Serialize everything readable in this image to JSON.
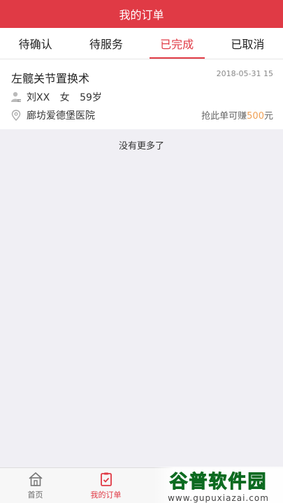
{
  "header": {
    "title": "我的订单"
  },
  "tabs": [
    {
      "label": "待确认"
    },
    {
      "label": "待服务"
    },
    {
      "label": "已完成"
    },
    {
      "label": "已取消"
    }
  ],
  "active_tab_index": 2,
  "order": {
    "procedure": "左髋关节置换术",
    "datetime": "2018-05-31 15",
    "patient_name": "刘XX",
    "patient_gender": "女",
    "patient_age": "59岁",
    "hospital": "廊坊爱德堡医院",
    "earn_prefix": "抢此单可赚",
    "earn_amount": "500",
    "earn_unit": "元"
  },
  "list_end_text": "没有更多了",
  "tabbar": [
    {
      "label": "首页",
      "icon": "home-icon"
    },
    {
      "label": "我的订单",
      "icon": "clipboard-check-icon"
    }
  ],
  "watermark": {
    "text": "谷普软件园",
    "url": "www.gupuxiazai.com"
  },
  "colors": {
    "accent": "#e03a45",
    "earn": "#f0a055",
    "watermark": "#1e9b3a"
  }
}
